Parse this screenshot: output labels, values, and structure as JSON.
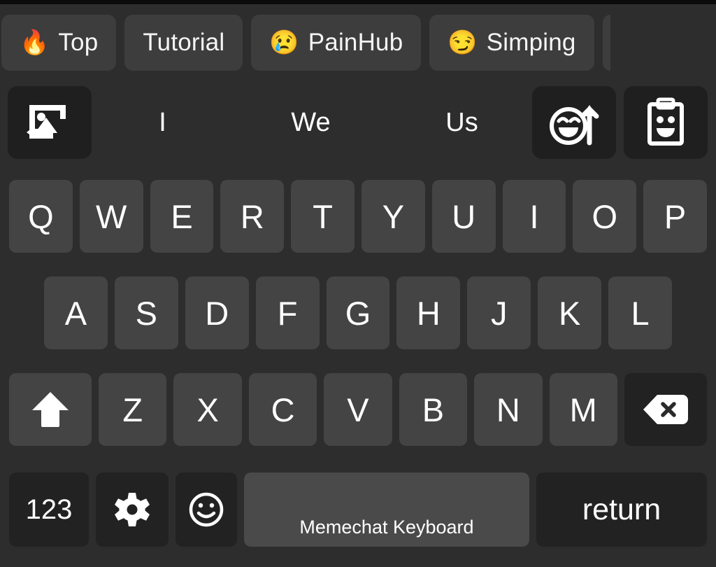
{
  "app": {
    "name": "Memechat Keyboard",
    "theme": "dark",
    "colors": {
      "background": "#2d2d2d",
      "key": "#444444",
      "key_dark": "#222222",
      "spacebar": "#4a4a4a",
      "tab": "#3d3d3d",
      "text": "#ffffff",
      "divider": "#8a8a8a"
    }
  },
  "tab_bar": {
    "tabs": [
      {
        "emoji": "🔥",
        "label": "Top",
        "name": "tab-top"
      },
      {
        "emoji": "",
        "label": "Tutorial",
        "name": "tab-tutorial"
      },
      {
        "emoji": "😢",
        "label": "PainHub",
        "name": "tab-painhub"
      },
      {
        "emoji": "😏",
        "label": "Simping",
        "name": "tab-simping"
      },
      {
        "emoji": "",
        "label": "",
        "name": "tab-partial"
      }
    ]
  },
  "suggestion_bar": {
    "image_button_icon": "image-import-icon",
    "suggestions": [
      "I",
      "We",
      "Us"
    ],
    "share_button_icon": "meme-share-icon",
    "clipboard_button_icon": "meme-clipboard-icon"
  },
  "keyboard": {
    "row_1": [
      "Q",
      "W",
      "E",
      "R",
      "T",
      "Y",
      "U",
      "I",
      "O",
      "P"
    ],
    "row_2": [
      "A",
      "S",
      "D",
      "F",
      "G",
      "H",
      "J",
      "K",
      "L"
    ],
    "row_3": {
      "shift_icon": "shift-arrow-icon",
      "letters": [
        "Z",
        "X",
        "C",
        "V",
        "B",
        "N",
        "M"
      ],
      "backspace_icon": "backspace-icon"
    },
    "row_4": {
      "numbers_label": "123",
      "settings_icon": "gear-icon",
      "emoji_icon": "smiley-icon",
      "space_label": "Memechat Keyboard",
      "return_label": "return"
    }
  }
}
